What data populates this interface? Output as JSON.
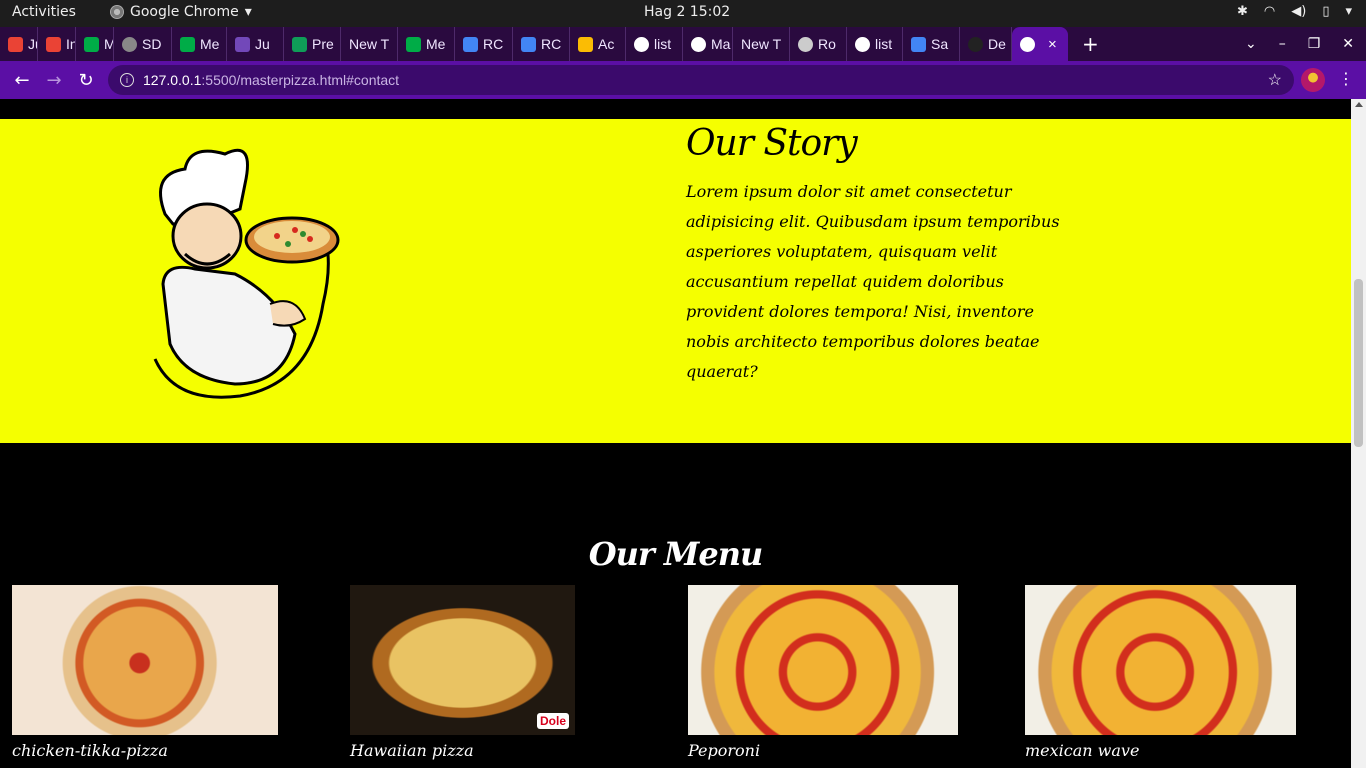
{
  "system_bar": {
    "activities": "Activities",
    "app_name": "Google Chrome",
    "clock": "Hag 2  15:02"
  },
  "browser": {
    "tabs": [
      {
        "label": "Ju",
        "favicon": "gmail-icon",
        "color": "#ea4335"
      },
      {
        "label": "Inv",
        "favicon": "gmail-icon",
        "color": "#ea4335"
      },
      {
        "label": "Me",
        "favicon": "meet-icon",
        "color": "#00ac47"
      },
      {
        "label": "SD",
        "favicon": "loading-icon",
        "color": "#888888"
      },
      {
        "label": "Me",
        "favicon": "meet-icon",
        "color": "#00ac47"
      },
      {
        "label": "Ju",
        "favicon": "forms-icon",
        "color": "#7248b9"
      },
      {
        "label": "Pre",
        "favicon": "sheets-icon",
        "color": "#0f9d58"
      },
      {
        "label": "New T",
        "favicon": "",
        "color": ""
      },
      {
        "label": "Me",
        "favicon": "meet-icon",
        "color": "#00ac47"
      },
      {
        "label": "RC",
        "favicon": "docs-icon",
        "color": "#4285f4"
      },
      {
        "label": "RC",
        "favicon": "docs-icon",
        "color": "#4285f4"
      },
      {
        "label": "Ac",
        "favicon": "drive-icon",
        "color": "#fbbc04"
      },
      {
        "label": "list",
        "favicon": "globe-icon",
        "color": "#ffffff"
      },
      {
        "label": "Ma",
        "favicon": "globe-icon",
        "color": "#ffffff"
      },
      {
        "label": "New T",
        "favicon": "",
        "color": ""
      },
      {
        "label": "Ro",
        "favicon": "wordpress-icon",
        "color": "#cccccc"
      },
      {
        "label": "list",
        "favicon": "globe-icon",
        "color": "#ffffff"
      },
      {
        "label": "Sa",
        "favicon": "docs-icon",
        "color": "#4285f4"
      },
      {
        "label": "De",
        "favicon": "github-icon",
        "color": "#222222"
      }
    ],
    "active_tab_close": "×",
    "new_tab": "+",
    "url_host": "127.0.0.1",
    "url_path": ":5500/masterpizza.html#contact"
  },
  "page": {
    "story": {
      "title": "Our Story",
      "text": "Lorem ipsum dolor sit amet consectetur adipisicing elit. Quibusdam ipsum temporibus asperiores voluptatem, quisquam velit accusantium repellat quidem doloribus provident dolores tempora! Nisi, inventore nobis architecto temporibus dolores beatae quaerat?",
      "background": "#f5ff00"
    },
    "menu": {
      "title": "Our Menu",
      "items": [
        {
          "name": "chicken-tikka-pizza"
        },
        {
          "name": "Hawaiian pizza",
          "badge": "Dole"
        },
        {
          "name": "Peporoni"
        },
        {
          "name": "mexican wave"
        }
      ]
    }
  }
}
